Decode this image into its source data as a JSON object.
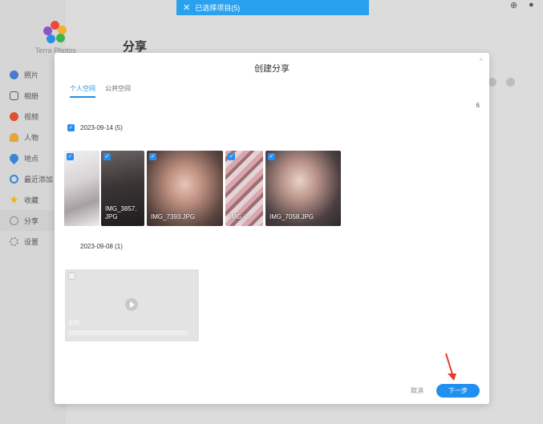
{
  "app": {
    "logo_text": "Terra Photos",
    "page_heading": "分享",
    "sidebar": [
      {
        "label": "照片",
        "icon": "photo-icon",
        "color": "#4a7bd0"
      },
      {
        "label": "相册",
        "icon": "album-icon",
        "color": "#5a5a5a"
      },
      {
        "label": "视频",
        "icon": "video-icon",
        "color": "#e0502d"
      },
      {
        "label": "人物",
        "icon": "person-icon",
        "color": "#e8a33a"
      },
      {
        "label": "地点",
        "icon": "location-icon",
        "color": "#3a86d6"
      },
      {
        "label": "最近添加",
        "icon": "recent-icon",
        "color": "#3a86d6"
      },
      {
        "label": "收藏",
        "icon": "star-icon",
        "color": "#f0b419"
      },
      {
        "label": "分享",
        "icon": "share-icon",
        "color": "#8a8a8a",
        "active": true
      },
      {
        "label": "设置",
        "icon": "settings-icon",
        "color": "#8a8a8a"
      }
    ]
  },
  "selection_bar": {
    "close_glyph": "✕",
    "text": "已选择项目(5)"
  },
  "dialog": {
    "title": "创建分享",
    "close_glyph": "×",
    "tabs": [
      {
        "label": "个人空间",
        "active": true
      },
      {
        "label": "公共空间",
        "active": false
      }
    ],
    "total_count": "6",
    "groups": [
      {
        "date": "2023-09-14 (5)",
        "checked": true,
        "items": [
          {
            "name": "",
            "checked": true
          },
          {
            "name": "IMG_3857.\nJPG",
            "checked": true
          },
          {
            "name": "IMG_7393.JPG",
            "checked": true
          },
          {
            "name": "IMG_7.",
            "checked": true
          },
          {
            "name": "IMG_7058.JPG",
            "checked": true
          }
        ]
      },
      {
        "date": "2023-09-08 (1)",
        "checked": false,
        "items": [
          {
            "name": "视频",
            "checked": false
          }
        ]
      }
    ],
    "cancel_label": "取消",
    "next_label": "下一步"
  },
  "colors": {
    "accent": "#1f8ff0",
    "banner": "#2aa1ee",
    "arrow": "#e8392b"
  }
}
